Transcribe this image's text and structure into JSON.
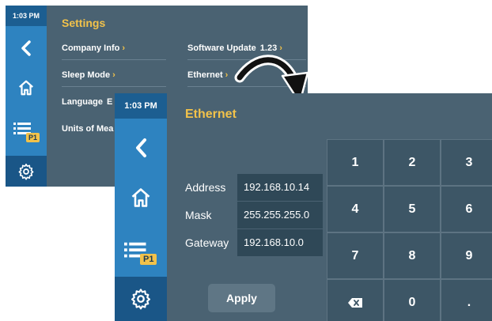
{
  "back_screen": {
    "status": {
      "time": "1:03 PM"
    },
    "title": "Settings",
    "items": [
      {
        "label": "Company Info",
        "chevron": "›"
      },
      {
        "label": "Sleep Mode",
        "chevron": "›"
      },
      {
        "label": "Language",
        "value": "E"
      },
      {
        "label": "Units of Mea"
      }
    ],
    "right_items": [
      {
        "label": "Software Update",
        "value": "1.23",
        "chevron": "›"
      },
      {
        "label": "Ethernet",
        "chevron": "›"
      }
    ],
    "sidebar": {
      "badge": "P1"
    }
  },
  "front_screen": {
    "status": {
      "time": "1:03 PM"
    },
    "title": "Ethernet",
    "sidebar": {
      "badge": "P1"
    },
    "fields": [
      {
        "label": "Address",
        "value": "192.168.10.14"
      },
      {
        "label": "Mask",
        "value": "255.255.255.0"
      },
      {
        "label": "Gateway",
        "value": "192.168.10.0"
      }
    ],
    "apply_label": "Apply",
    "keypad": {
      "keys": [
        "1",
        "2",
        "3",
        "4",
        "5",
        "6",
        "7",
        "8",
        "9",
        "",
        "0",
        "."
      ],
      "backspace_icon": "backspace-icon"
    }
  },
  "icons": {
    "back": "back-arrow-icon",
    "home": "home-icon",
    "list": "list-icon",
    "settings": "gear-icon"
  },
  "colors": {
    "sidebar": "#2e83c0",
    "sidebar_active": "#1a5687",
    "panel": "#4a6272",
    "accent": "#f2c24a",
    "key": "#3d5666"
  }
}
